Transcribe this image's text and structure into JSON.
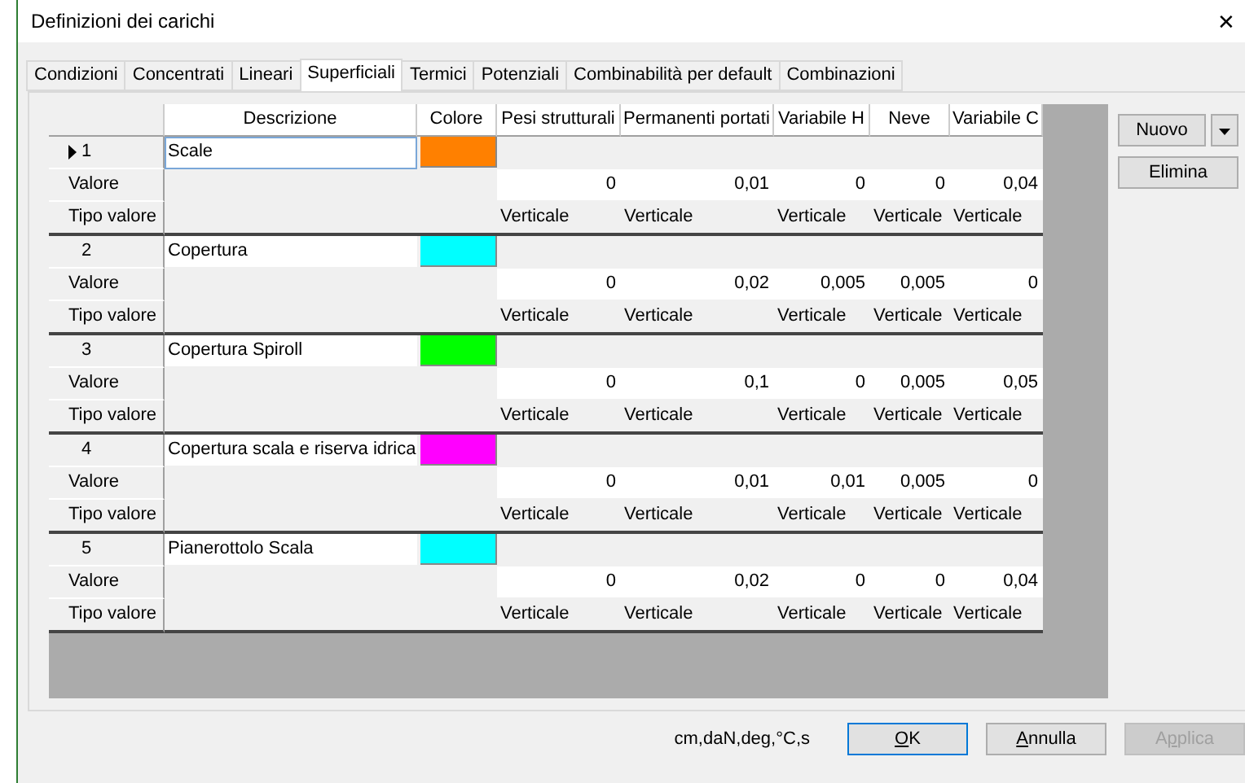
{
  "window": {
    "title": "Definizioni dei carichi",
    "close": "✕"
  },
  "tabs": [
    {
      "label": "Condizioni",
      "selected": false
    },
    {
      "label": "Concentrati",
      "selected": false
    },
    {
      "label": "Lineari",
      "selected": false
    },
    {
      "label": "Superficiali",
      "selected": true
    },
    {
      "label": "Termici",
      "selected": false
    },
    {
      "label": "Potenziali",
      "selected": false
    },
    {
      "label": "Combinabilità per default",
      "selected": false
    },
    {
      "label": "Combinazioni",
      "selected": false
    }
  ],
  "table": {
    "columns": [
      "Descrizione",
      "Colore",
      "Pesi strutturali",
      "Permanenti portati",
      "Variabile H",
      "Neve",
      "Variabile C"
    ],
    "rows": [
      {
        "number": "1",
        "description": "Scale",
        "color": "#ff8000",
        "selected": true,
        "value_label": "Valore",
        "values": [
          "0",
          "0,01",
          "0",
          "0",
          "0,04"
        ],
        "type_label": "Tipo valore",
        "types": [
          "Verticale",
          "Verticale",
          "Verticale",
          "Verticale",
          "Verticale"
        ]
      },
      {
        "number": "2",
        "description": "Copertura",
        "color": "#00ffff",
        "selected": false,
        "value_label": "Valore",
        "values": [
          "0",
          "0,02",
          "0,005",
          "0,005",
          "0"
        ],
        "type_label": "Tipo valore",
        "types": [
          "Verticale",
          "Verticale",
          "Verticale",
          "Verticale",
          "Verticale"
        ]
      },
      {
        "number": "3",
        "description": "Copertura Spiroll",
        "color": "#00ff00",
        "selected": false,
        "value_label": "Valore",
        "values": [
          "0",
          "0,1",
          "0",
          "0,005",
          "0,05"
        ],
        "type_label": "Tipo valore",
        "types": [
          "Verticale",
          "Verticale",
          "Verticale",
          "Verticale",
          "Verticale"
        ]
      },
      {
        "number": "4",
        "description": "Copertura scala e riserva idrica",
        "color": "#ff00ff",
        "selected": false,
        "value_label": "Valore",
        "values": [
          "0",
          "0,01",
          "0,01",
          "0,005",
          "0"
        ],
        "type_label": "Tipo valore",
        "types": [
          "Verticale",
          "Verticale",
          "Verticale",
          "Verticale",
          "Verticale"
        ]
      },
      {
        "number": "5",
        "description": "Pianerottolo Scala",
        "color": "#00ffff",
        "selected": false,
        "value_label": "Valore",
        "values": [
          "0",
          "0,02",
          "0",
          "0",
          "0,04"
        ],
        "type_label": "Tipo valore",
        "types": [
          "Verticale",
          "Verticale",
          "Verticale",
          "Verticale",
          "Verticale"
        ]
      }
    ]
  },
  "side_buttons": {
    "new": "Nuovo",
    "delete": "Elimina"
  },
  "units": "cm,daN,deg,°C,s",
  "buttons": [
    {
      "label_key": "O",
      "label_rest": "K",
      "default": true,
      "disabled": false
    },
    {
      "label_key": "A",
      "label_rest": "nnulla",
      "default": false,
      "disabled": false
    },
    {
      "label_start": "A",
      "label_key": "p",
      "label_rest": "plica",
      "default": false,
      "disabled": true
    }
  ]
}
